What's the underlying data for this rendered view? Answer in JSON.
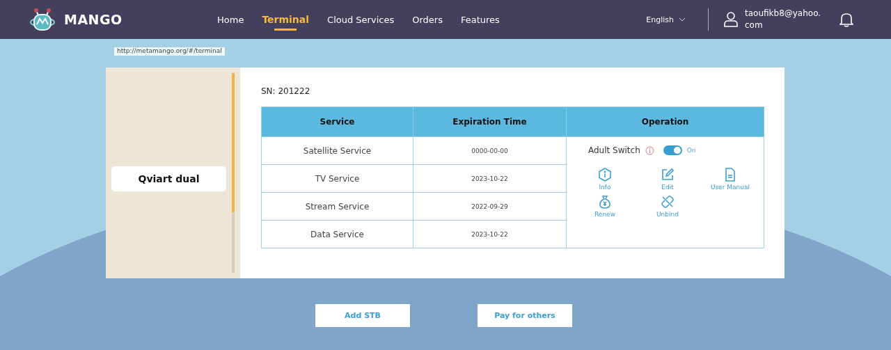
{
  "header": {
    "logo": "MANGO",
    "nav": [
      {
        "label": "Home",
        "selected": false
      },
      {
        "label": "Terminal",
        "selected": true
      },
      {
        "label": "Cloud Services",
        "selected": false
      },
      {
        "label": "Orders",
        "selected": false
      },
      {
        "label": "Features",
        "selected": false
      }
    ],
    "language": "English",
    "user": "taoufikb8@yahoo.com"
  },
  "url_tooltip": "http://metamango.org/#/terminal",
  "devices": [
    {
      "name": "Qviart dual",
      "selected": true
    }
  ],
  "sn": "SN: 201222",
  "table": {
    "columns": [
      "Service",
      "Expiration Time",
      "Operation"
    ],
    "rows": [
      {
        "service": "Satellite Service",
        "expiration": "0000-00-00"
      },
      {
        "service": "TV Service",
        "expiration": "2023-10-22"
      },
      {
        "service": "Stream Service",
        "expiration": "2022-09-29"
      },
      {
        "service": "Data Service",
        "expiration": "2023-10-22"
      }
    ],
    "adult_switch": {
      "label": "Adult Switch",
      "on": true,
      "state_label": "On"
    },
    "actions": [
      "Info",
      "Edit",
      "User Manual",
      "Renew",
      "Unbind"
    ]
  },
  "buttons": [
    "Add STB",
    "Pay for others"
  ]
}
